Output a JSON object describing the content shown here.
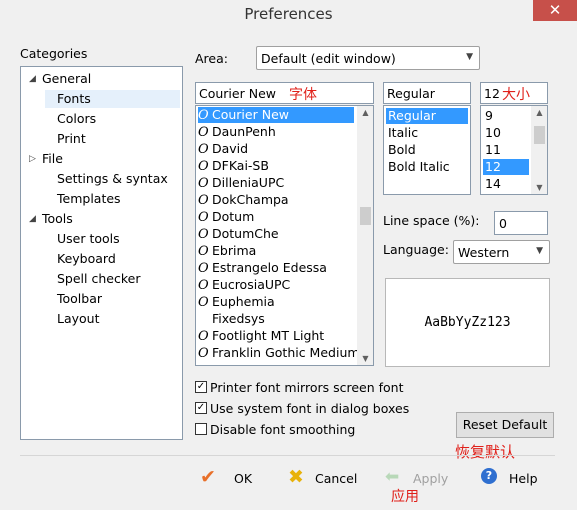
{
  "window": {
    "title": "Preferences",
    "close_glyph": "✕"
  },
  "categories": {
    "label": "Categories",
    "items": [
      {
        "label": "General",
        "expander": "◢"
      },
      {
        "label": "Fonts"
      },
      {
        "label": "Colors"
      },
      {
        "label": "Print"
      },
      {
        "label": "File",
        "expander": "▷"
      },
      {
        "label": "Settings & syntax"
      },
      {
        "label": "Templates"
      },
      {
        "label": "Tools",
        "expander": "◢"
      },
      {
        "label": "User tools"
      },
      {
        "label": "Keyboard"
      },
      {
        "label": "Spell checker"
      },
      {
        "label": "Toolbar"
      },
      {
        "label": "Layout"
      }
    ],
    "selected": "Fonts"
  },
  "area": {
    "label": "Area:",
    "value": "Default (edit window)"
  },
  "font": {
    "value": "Courier New",
    "annotation": "字体",
    "glyph": "O",
    "list": [
      {
        "name": "Courier New",
        "icon": true,
        "selected": true
      },
      {
        "name": "DaunPenh",
        "icon": true
      },
      {
        "name": "David",
        "icon": true
      },
      {
        "name": "DFKai-SB",
        "icon": true
      },
      {
        "name": "DilleniaUPC",
        "icon": true
      },
      {
        "name": "DokChampa",
        "icon": true
      },
      {
        "name": "Dotum",
        "icon": true
      },
      {
        "name": "DotumChe",
        "icon": true
      },
      {
        "name": "Ebrima",
        "icon": true
      },
      {
        "name": "Estrangelo Edessa",
        "icon": true
      },
      {
        "name": "EucrosiaUPC",
        "icon": true
      },
      {
        "name": "Euphemia",
        "icon": true
      },
      {
        "name": "Fixedsys",
        "icon": false
      },
      {
        "name": "Footlight MT Light",
        "icon": true
      },
      {
        "name": "Franklin Gothic Medium",
        "icon": true
      }
    ]
  },
  "style": {
    "value": "Regular",
    "list": [
      "Regular",
      "Italic",
      "Bold",
      "Bold Italic"
    ],
    "selected": "Regular"
  },
  "size": {
    "value": "12",
    "annotation": "大小",
    "list": [
      "9",
      "10",
      "11",
      "12",
      "14"
    ],
    "selected": "12"
  },
  "line_space": {
    "label": "Line space (%):",
    "value": "0"
  },
  "language": {
    "label": "Language:",
    "value": "Western"
  },
  "preview": {
    "text": "AaBbYyZz123"
  },
  "options": [
    {
      "label": "Printer font mirrors screen font",
      "checked": true
    },
    {
      "label": "Use system font in dialog boxes",
      "checked": true
    },
    {
      "label": "Disable font smoothing",
      "checked": false
    }
  ],
  "reset_button": {
    "label": "Reset Default",
    "annotation": "恢复默认"
  },
  "footer": {
    "ok": "OK",
    "cancel": "Cancel",
    "apply": "Apply",
    "apply_annotation": "应用",
    "help": "Help"
  },
  "colors": {
    "selection": "#3399ff",
    "annotation": "#e0201a",
    "ok_check": "#e8702a",
    "cancel_x": "#e8b20a",
    "help": "#2f6fd0"
  },
  "icons": [
    "close-icon",
    "check-icon",
    "cancel-x-icon",
    "apply-arrow-icon",
    "help-icon",
    "font-type-icon"
  ]
}
